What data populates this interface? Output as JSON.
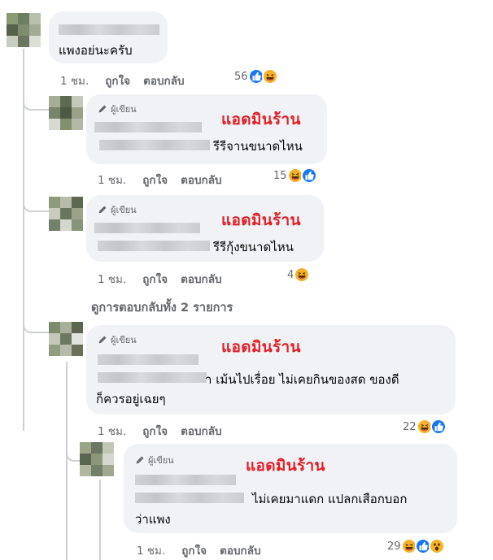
{
  "comments": [
    {
      "body": "แพงอย่นะครับ",
      "actions": {
        "time": "1 ชม.",
        "like": "ถูกใจ",
        "reply": "ตอบกลับ"
      },
      "reaction_count": "56",
      "reactions": [
        "like",
        "haha"
      ]
    },
    {
      "author_badge": "ผู้เขียน",
      "admin_label": "แอดมินร้าน",
      "body": "รีรีจานขนาดไหน",
      "actions": {
        "time": "1 ชม.",
        "like": "ถูกใจ",
        "reply": "ตอบกลับ"
      },
      "reaction_count": "15",
      "reactions": [
        "haha",
        "like"
      ]
    },
    {
      "author_badge": "ผู้เขียน",
      "admin_label": "แอดมินร้าน",
      "body": "รีรีกุ้งขนาดไหน",
      "actions": {
        "time": "1 ชม.",
        "like": "ถูกใจ",
        "reply": "ตอบกลับ"
      },
      "reaction_count": "4",
      "reactions": [
        "haha"
      ]
    },
    {
      "author_badge": "ผู้เขียน",
      "admin_label": "แอดมินร้าน",
      "body_line1": "า เม้นไปเรื่อย ไม่เคยกินของสด ของดี",
      "body_line2": "ก็ควรอยู่เฉยๆ",
      "actions": {
        "time": "1 ชม.",
        "like": "ถูกใจ",
        "reply": "ตอบกลับ"
      },
      "reaction_count": "22",
      "reactions": [
        "haha",
        "like"
      ]
    },
    {
      "author_badge": "ผู้เขียน",
      "admin_label": "แอดมินร้าน",
      "body_line1": "ไม่เคยมาแดก แปลกเสือกบอก",
      "body_line2": "ว่าแพง",
      "actions": {
        "time": "1 ชม.",
        "like": "ถูกใจ",
        "reply": "ตอบกลับ"
      },
      "reaction_count": "29",
      "reactions": [
        "haha",
        "like",
        "wow"
      ]
    }
  ],
  "view_more_replies": "ดูการตอบกลับทั้ง 2 รายการ",
  "colors": {
    "admin_label": "#e41e26",
    "bubble_bg": "#f0f2f5",
    "secondary_text": "#65676b",
    "like_blue": "#1877f2",
    "emoji_yellow": "#f7b125"
  }
}
